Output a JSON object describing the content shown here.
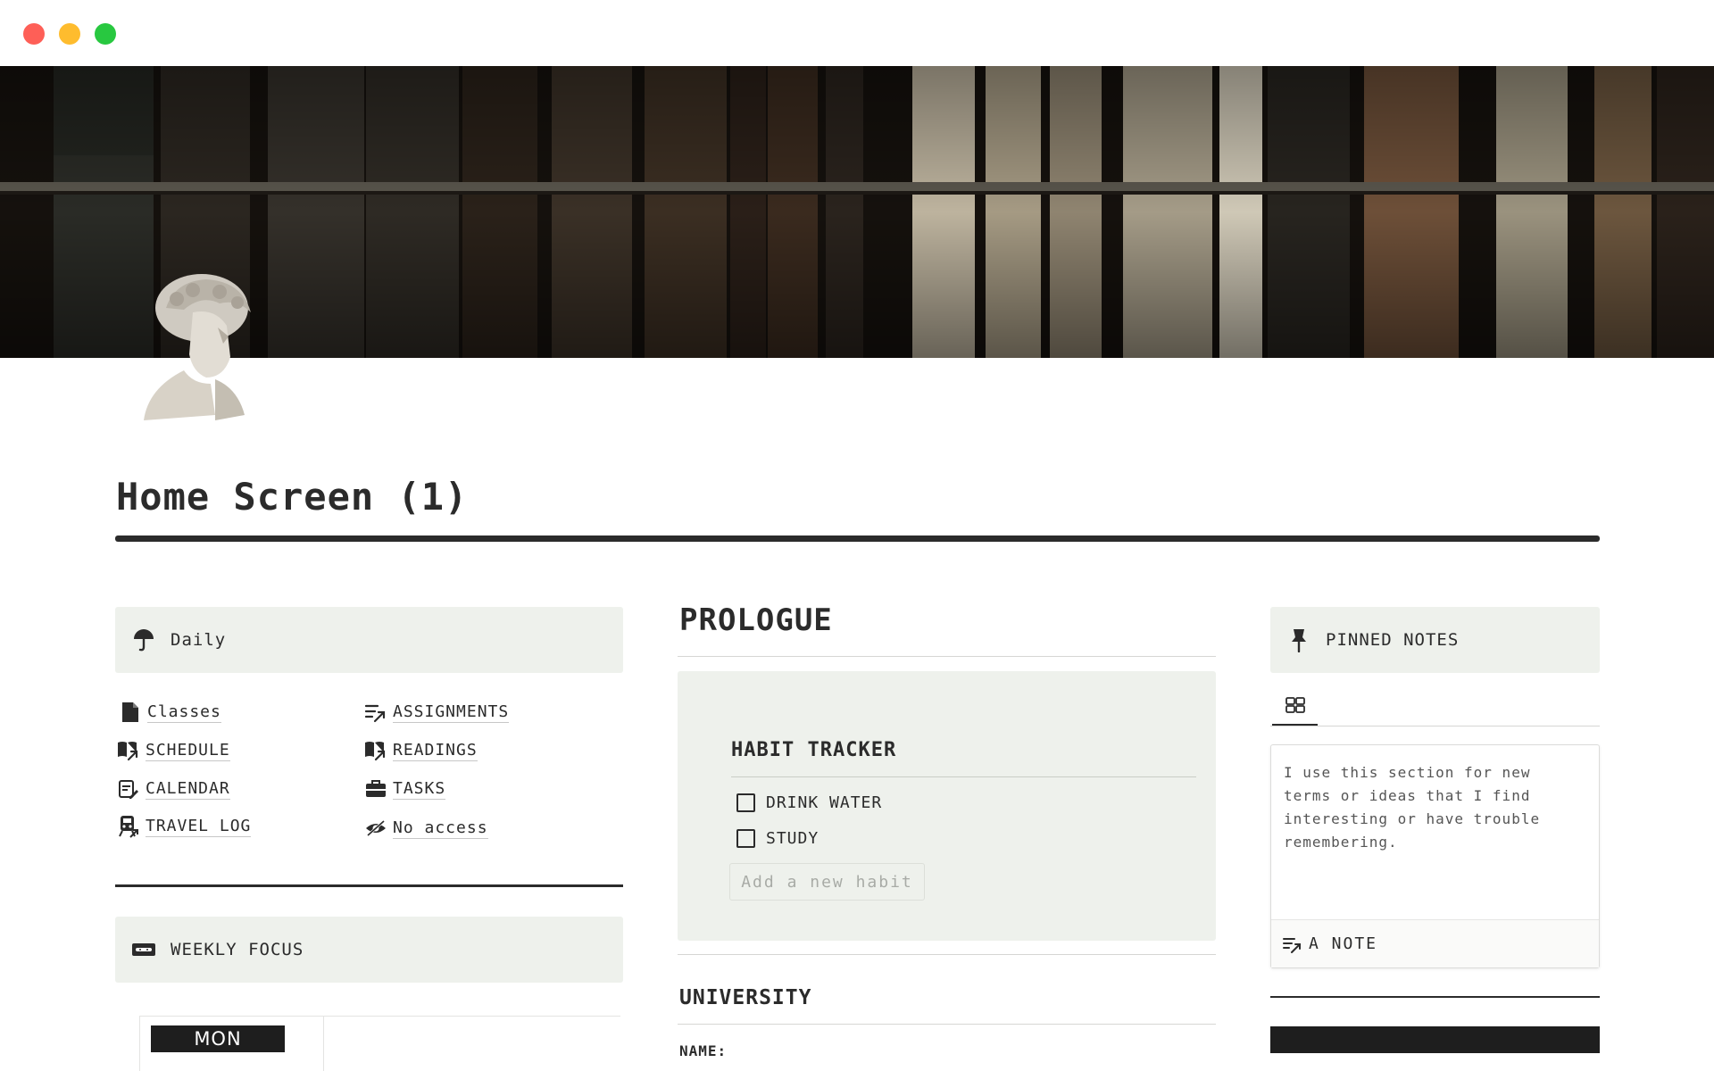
{
  "window": {
    "controls": [
      "close",
      "minimize",
      "maximize"
    ]
  },
  "page": {
    "title": "Home Screen (1)",
    "cover_icon": "library-bookshelf-image",
    "page_icon": "david-bust-image"
  },
  "left_column": {
    "daily_callout": {
      "icon": "umbrella-icon",
      "label": "Daily"
    },
    "links": [
      {
        "icon": "document-icon",
        "label": "Classes"
      },
      {
        "icon": "checklist-arrow-icon",
        "label": "ASSIGNMENTS"
      },
      {
        "icon": "book-arrow-icon",
        "label": "SCHEDULE"
      },
      {
        "icon": "book-arrow-icon",
        "label": "READINGS"
      },
      {
        "icon": "calendar-edit-icon",
        "label": "CALENDAR"
      },
      {
        "icon": "briefcase-icon",
        "label": "TASKS"
      },
      {
        "icon": "train-icon",
        "label": "TRAVEL LOG"
      },
      {
        "icon": "eye-slash-icon",
        "label": "No access"
      }
    ],
    "weekly_callout": {
      "icon": "ticket-icon",
      "label": "WEEKLY FOCUS"
    },
    "week_day": "MON"
  },
  "middle_column": {
    "prologue_heading": "PROLOGUE",
    "habit_tracker": {
      "title": "HABIT TRACKER",
      "habits": [
        {
          "label": "DRINK WATER",
          "checked": false
        },
        {
          "label": "STUDY",
          "checked": false
        }
      ],
      "add_placeholder": "Add a new habit"
    },
    "university_heading": "UNIVERSITY",
    "name_label": "NAME:"
  },
  "right_column": {
    "pinned_callout": {
      "icon": "pushpin-icon",
      "label": "PINNED NOTES"
    },
    "view_tab_icon": "gallery-grid-icon",
    "note_card": {
      "text": "I use this section for new terms or ideas that I find interesting or have trouble remembering."
    },
    "new_note": {
      "icon": "checklist-arrow-icon",
      "label": "A NOTE"
    }
  },
  "colors": {
    "callout_bg": "#eef1ec",
    "text": "#2b2b2b",
    "accent_dark": "#1e1e1e"
  }
}
